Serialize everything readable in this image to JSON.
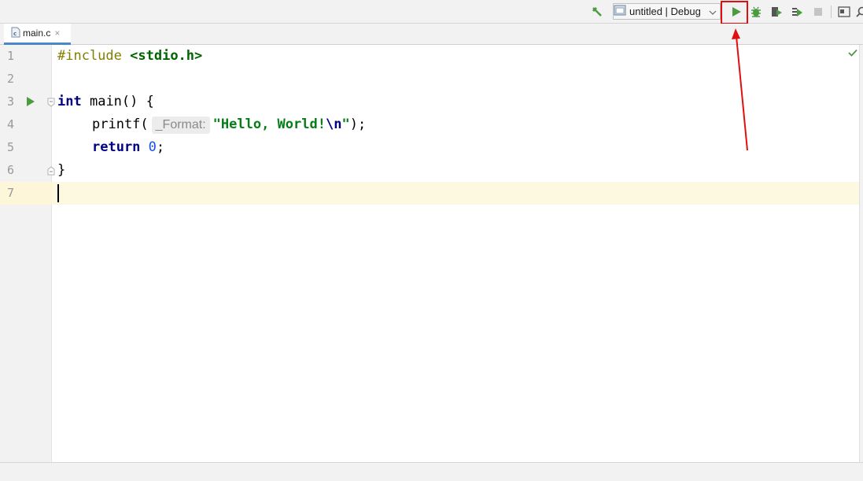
{
  "toolbar": {
    "run_config": "untitled | Debug",
    "icons": [
      "hammer-icon",
      "config-file-icon",
      "chevron-down-icon",
      "run-icon",
      "debug-icon",
      "coverage-icon",
      "profile-icon",
      "stop-icon",
      "layout-icon",
      "search-icon"
    ]
  },
  "colors": {
    "run_green": "#4c9b41",
    "highlight_red": "#e01010",
    "tab_underline": "#4a88c7",
    "caret_row": "#fdf8e0"
  },
  "tabs": [
    {
      "label": "main.c",
      "close": "×",
      "active": true
    }
  ],
  "editor": {
    "line_numbers": [
      "1",
      "2",
      "3",
      "4",
      "5",
      "6",
      "7"
    ],
    "lines": {
      "l1": {
        "directive": "#include",
        "header": "<stdio.h>"
      },
      "l3": {
        "type": "int",
        "rest": "main() {"
      },
      "l4": {
        "call": "printf(",
        "hint": "_Format:",
        "str_open": "\"Hello, World!",
        "esc": "\\n",
        "str_close": "\"",
        "end": ");"
      },
      "l5": {
        "keyword": "return",
        "value": "0",
        "end": ";"
      },
      "l6": {
        "brace": "}"
      }
    }
  }
}
